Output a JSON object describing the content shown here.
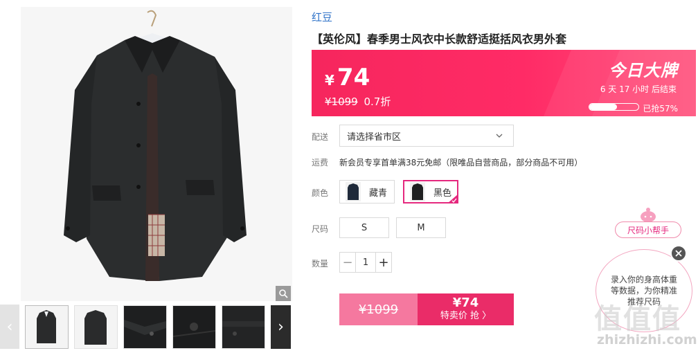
{
  "product": {
    "brand": "红豆",
    "title": "【英伦风】春季男士风衣中长款舒适挺括风衣男外套"
  },
  "price": {
    "currency": "¥",
    "current": "74",
    "original": "¥1099",
    "discount": "0.7折",
    "promo_title": "今日大牌",
    "countdown": "6 天 17 小时 后结束",
    "sold_progress": 0.57,
    "sold_text": "已抢57%",
    "colors": {
      "banner": "#f6265d",
      "accent": "#e5287e"
    }
  },
  "delivery": {
    "label": "配送",
    "select_value": "请选择省市区"
  },
  "shipping": {
    "label": "运费",
    "text": "新会员专享首单满38元免邮（限唯品自营商品，部分商品不可用）"
  },
  "color": {
    "label": "颜色",
    "options": [
      {
        "label": "藏青",
        "selected": false
      },
      {
        "label": "黑色",
        "selected": true
      }
    ]
  },
  "size": {
    "label": "尺码",
    "options": [
      "S",
      "M"
    ]
  },
  "quantity": {
    "label": "数量",
    "minus": "−",
    "value": "1",
    "plus": "+"
  },
  "buy": {
    "original": "¥1099",
    "price": "¥74",
    "label": "特卖价 抢 〉"
  },
  "size_helper": {
    "tag": "尺码小帮手",
    "message": "录入你的身高体重等数据，为你精准推荐尺码"
  },
  "gallery": {
    "prev_icon": "chevron-left-icon",
    "next_icon": "chevron-right-icon",
    "zoom_icon": "magnifier-icon"
  },
  "watermark": {
    "glyphs": "值值值",
    "url": "zhizhizhi.com"
  }
}
